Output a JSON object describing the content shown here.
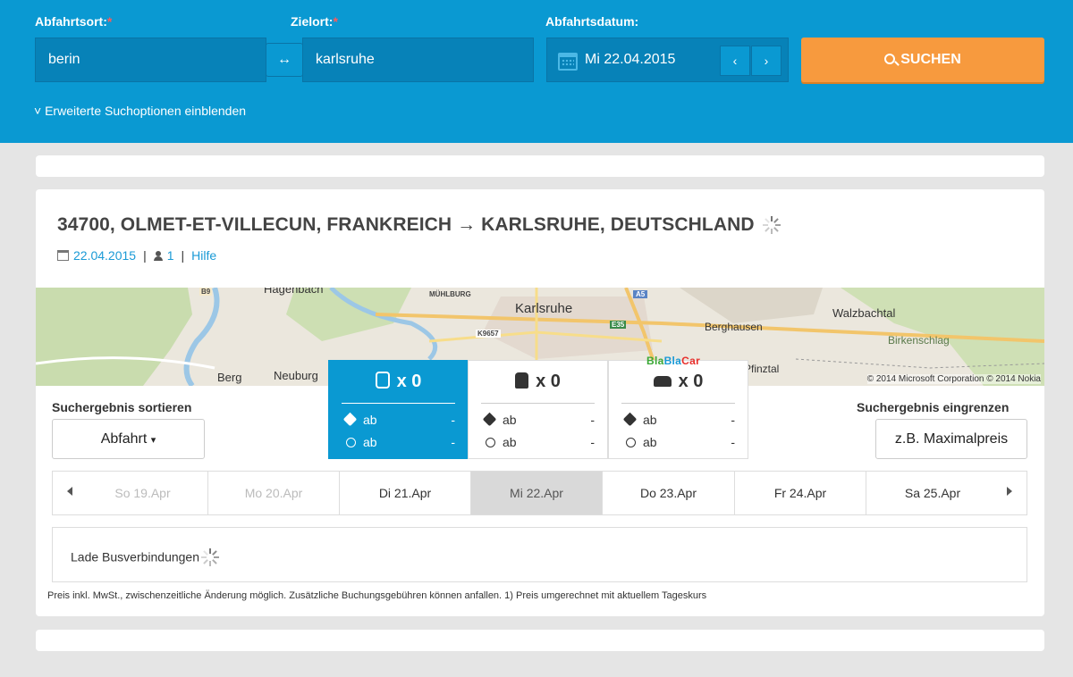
{
  "search": {
    "origin_label": "Abfahrtsort:",
    "origin_value": "berin",
    "dest_label": "Zielort:",
    "dest_value": "karlsruhe",
    "required_mark": "*",
    "swap_icon": "↔",
    "date_label": "Abfahrtsdatum:",
    "date_value": "Mi 22.04.2015",
    "prev_icon": "‹",
    "next_icon": "›",
    "search_button": "SUCHEN",
    "advanced_link": "Erweiterte Suchoptionen einblenden",
    "advanced_chevron": "˅"
  },
  "route": {
    "title": "34700, OLMET-ET-VILLECUN, FRANKREICH → KARLSRUHE, DEUTSCHLAND",
    "date": "22.04.2015",
    "passengers": "1",
    "help": "Hilfe",
    "separator": "|"
  },
  "map": {
    "labels": [
      "Hagenbach",
      "Karlsruhe",
      "Berghausen",
      "Walzbachtal",
      "Birkenschlag",
      "Berg",
      "Neuburg",
      "Pfinztal"
    ],
    "small_labels": [
      "B9",
      "MÜHLBURG",
      "A5",
      "K9657",
      "E35"
    ],
    "credit": "© 2014 Microsoft Corporation © 2014 Nokia"
  },
  "modes": [
    {
      "name": "bus",
      "count": "x 0",
      "price_label": "ab",
      "price_value": "-",
      "time_label": "ab",
      "time_value": "-"
    },
    {
      "name": "train",
      "count": "x 0",
      "price_label": "ab",
      "price_value": "-",
      "time_label": "ab",
      "time_value": "-"
    },
    {
      "name": "car",
      "count": "x 0",
      "price_label": "ab",
      "price_value": "-",
      "time_label": "ab",
      "time_value": "-"
    }
  ],
  "blablacar": {
    "part1": "Bla",
    "part2": "Bla",
    "part3": "Car",
    "color1": "#3aa835",
    "color2": "#1a9ad6",
    "color3": "#e8302c"
  },
  "sort": {
    "label": "Suchergebnis sortieren",
    "button": "Abfahrt",
    "caret": "▾"
  },
  "filter": {
    "label": "Suchergebnis eingrenzen",
    "button": "z.B. Maximalpreis"
  },
  "days": [
    "So 19.Apr",
    "Mo 20.Apr",
    "Di 21.Apr",
    "Mi 22.Apr",
    "Do 23.Apr",
    "Fr 24.Apr",
    "Sa 25.Apr"
  ],
  "loading": "Lade Busverbindungen",
  "footnote": "Preis inkl. MwSt., zwischenzeitliche Änderung möglich. Zusätzliche Buchungsgebühren können anfallen. 1) Preis umgerechnet mit aktuellem Tageskurs",
  "colors": {
    "header": "#0a99d2",
    "accent": "#f79a3e",
    "link": "#1a9ad6"
  }
}
